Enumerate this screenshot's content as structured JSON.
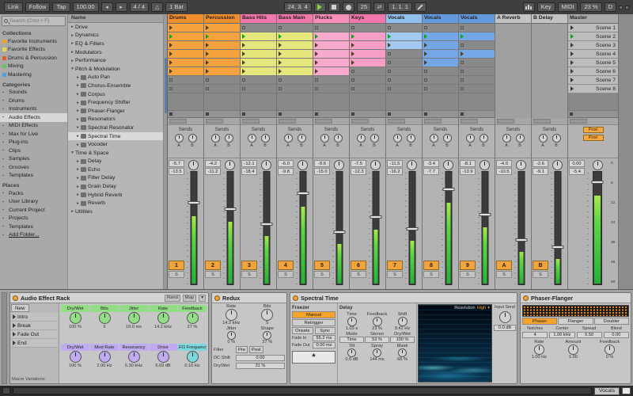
{
  "topbar": {
    "link": "Link",
    "follow": "Follow",
    "tap": "Tap",
    "tempo": "100.00",
    "timesig": "4 / 4",
    "quantize": "1 Bar",
    "position": "24. 3. 4",
    "loop_start": "25",
    "loop_length": "1. 1. 1",
    "key": "Key",
    "midi": "MIDI",
    "cpu": "23 %",
    "disk": "D"
  },
  "icons": {
    "dropdown": "▾",
    "metronome": "△",
    "nudge_left": "◂",
    "nudge_right": "▸",
    "loop": "⇄",
    "freeze": "*",
    "rack_fold": "▾"
  },
  "browser": {
    "search_placeholder": "Search (Cmd + F)",
    "name_header": "Name",
    "sections": [
      {
        "title": "Collections",
        "items": [
          {
            "label": "Favorite Instruments",
            "dot": "#f0a030"
          },
          {
            "label": "Favorite Effects",
            "dot": "#e8d84a"
          },
          {
            "label": "Drums & Percussion",
            "dot": "#e05c2c"
          },
          {
            "label": "Mixing",
            "dot": "#62c462"
          },
          {
            "label": "Mastering",
            "dot": "#50a0e0"
          }
        ]
      },
      {
        "title": "Categories",
        "items": [
          {
            "label": "Sounds"
          },
          {
            "label": "Drums"
          },
          {
            "label": "Instruments"
          },
          {
            "label": "Audio Effects",
            "selected": true
          },
          {
            "label": "MIDI Effects"
          },
          {
            "label": "Max for Live"
          },
          {
            "label": "Plug-ins"
          },
          {
            "label": "Clips"
          },
          {
            "label": "Samples"
          },
          {
            "label": "Grooves"
          },
          {
            "label": "Templates"
          }
        ]
      },
      {
        "title": "Places",
        "items": [
          {
            "label": "Packs"
          },
          {
            "label": "User Library"
          },
          {
            "label": "Current Project"
          },
          {
            "label": "Projects"
          },
          {
            "label": "Templates"
          },
          {
            "label": "Add Folder...",
            "underline": true
          }
        ]
      }
    ],
    "files": [
      {
        "label": "Drive",
        "arrow": "▸"
      },
      {
        "label": "Dynamics",
        "arrow": "▸"
      },
      {
        "label": "EQ & Filters",
        "arrow": "▸"
      },
      {
        "label": "Modulators",
        "arrow": "▸"
      },
      {
        "label": "Performance",
        "arrow": "▸"
      },
      {
        "label": "Pitch & Modulation",
        "arrow": "▾"
      },
      {
        "label": "Auto Pan",
        "arrow": "▸",
        "device": true,
        "indent": 1
      },
      {
        "label": "Chorus-Ensemble",
        "arrow": "▸",
        "device": true,
        "indent": 1
      },
      {
        "label": "Corpus",
        "arrow": "▸",
        "device": true,
        "indent": 1
      },
      {
        "label": "Frequency Shifter",
        "arrow": "▸",
        "device": true,
        "indent": 1
      },
      {
        "label": "Phaser-Flanger",
        "arrow": "▸",
        "device": true,
        "indent": 1
      },
      {
        "label": "Resonators",
        "arrow": "▸",
        "device": true,
        "indent": 1
      },
      {
        "label": "Spectral Resonator",
        "arrow": "▸",
        "device": true,
        "indent": 1
      },
      {
        "label": "Spectral Time",
        "arrow": "▸",
        "device": true,
        "indent": 1,
        "selected": true
      },
      {
        "label": "Vocoder",
        "arrow": "▸",
        "device": true,
        "indent": 1
      },
      {
        "label": "Time & Space",
        "arrow": "▾"
      },
      {
        "label": "Delay",
        "arrow": "▸",
        "device": true,
        "indent": 1
      },
      {
        "label": "Echo",
        "arrow": "▸",
        "device": true,
        "indent": 1
      },
      {
        "label": "Filter Delay",
        "arrow": "▸",
        "device": true,
        "indent": 1
      },
      {
        "label": "Grain Delay",
        "arrow": "▸",
        "device": true,
        "indent": 1
      },
      {
        "label": "Hybrid Reverb",
        "arrow": "▸",
        "device": true,
        "indent": 1
      },
      {
        "label": "Reverb",
        "arrow": "▸",
        "device": true,
        "indent": 1
      },
      {
        "label": "Utilities",
        "arrow": "▸"
      }
    ]
  },
  "session": {
    "sends_label": "Sends",
    "solo_label": "S",
    "send_letters": [
      "A",
      "B"
    ],
    "tracks": [
      {
        "name": "Drums",
        "hdr": "#ef8f2e",
        "clip": "#f5a23e",
        "num": "1",
        "slots": [
          1,
          2,
          1,
          1,
          1,
          1,
          0,
          0
        ],
        "vol": "-5.7",
        "peak": "-13.5",
        "meter": 60
      },
      {
        "name": "Percussion",
        "hdr": "#ef8f2e",
        "clip": "#f5a23e",
        "num": "2",
        "slots": [
          1,
          2,
          1,
          1,
          1,
          1,
          0,
          0
        ],
        "vol": "-4.2",
        "peak": "-11.2",
        "meter": 55
      },
      {
        "name": "Bass Hits",
        "hdr": "#f178ac",
        "clip": "#e5e77d",
        "num": "3",
        "slots": [
          0,
          2,
          1,
          1,
          1,
          1,
          0,
          0
        ],
        "vol": "-12.1",
        "peak": "-18.4",
        "meter": 42
      },
      {
        "name": "Bass Main",
        "hdr": "#f178ac",
        "clip": "#e5e77d",
        "num": "4",
        "slots": [
          0,
          2,
          1,
          1,
          1,
          1,
          0,
          0
        ],
        "vol": "-6.0",
        "peak": "-9.8",
        "meter": 68
      },
      {
        "name": "Plucks",
        "hdr": "#f78fba",
        "clip": "#f9a9cb",
        "num": "5",
        "slots": [
          0,
          2,
          1,
          1,
          1,
          1,
          0,
          0
        ],
        "vol": "-9.6",
        "peak": "-15.0",
        "meter": 35
      },
      {
        "name": "Keys",
        "hdr": "#f178ac",
        "clip": "#f79ec4",
        "num": "6",
        "slots": [
          0,
          2,
          1,
          1,
          1,
          0,
          0,
          0
        ],
        "vol": "-7.5",
        "peak": "-12.3",
        "meter": 48
      },
      {
        "name": "Vocals",
        "hdr": "#92c0ee",
        "clip": "#a3c9f1",
        "num": "7",
        "slots": [
          0,
          2,
          1,
          0,
          0,
          0,
          0,
          0
        ],
        "vol": "-11.5",
        "peak": "-16.2",
        "meter": 38
      },
      {
        "name": "Vocals",
        "hdr": "#639ade",
        "clip": "#74a7e6",
        "num": "8",
        "slots": [
          0,
          2,
          1,
          1,
          1,
          0,
          0,
          0
        ],
        "vol": "-3.4",
        "peak": "-7.7",
        "meter": 72
      },
      {
        "name": "Vocals",
        "hdr": "#639ade",
        "clip": "#74a7e6",
        "num": "9",
        "slots": [
          0,
          2,
          0,
          1,
          0,
          0,
          0,
          0
        ],
        "vol": "-8.1",
        "peak": "-13.9",
        "meter": 50
      },
      {
        "name": "A Reverb",
        "hdr": "#c3c3c3",
        "ret": true,
        "num": "A",
        "slots": [
          0,
          0,
          0,
          0,
          0,
          0,
          0,
          0
        ],
        "vol": "-4.0",
        "peak": "-10.5",
        "meter": 28
      },
      {
        "name": "B Delay",
        "hdr": "#c3c3c3",
        "ret": true,
        "num": "B",
        "slots": [
          0,
          0,
          0,
          0,
          0,
          0,
          0,
          0
        ],
        "vol": "-2.6",
        "peak": "-9.1",
        "meter": 22
      }
    ],
    "scenes": [
      {
        "label": "Scene 1"
      },
      {
        "label": "Scene 2",
        "playing": true
      },
      {
        "label": "Scene 3"
      },
      {
        "label": "Scene 4"
      },
      {
        "label": "Scene 5"
      },
      {
        "label": "Scene 6"
      },
      {
        "label": "Scene 7"
      },
      {
        "label": "Scene 8"
      }
    ],
    "master": {
      "name": "Master",
      "hdr": "#a9a9a9",
      "vol": "0.00",
      "peak": "-5.4",
      "meter": 78,
      "post_labels": [
        "Post",
        "Post"
      ],
      "scale": [
        "0",
        "6",
        "12",
        "24",
        "36",
        "48",
        "60"
      ]
    }
  },
  "devices": {
    "rack": {
      "title": "Audio Effect Rack",
      "rand_label": "Rand",
      "map_label": "Map",
      "new_label": "New",
      "variations": [
        "Intro",
        "Break",
        "Fade Out",
        "End"
      ],
      "variations_label": "Macro Variations",
      "macros": [
        {
          "label": "Dry/Wet",
          "value": "100 %",
          "color": "#93dd86"
        },
        {
          "label": "Bits",
          "value": "6",
          "color": "#93dd86"
        },
        {
          "label": "Jitter",
          "value": "10.0 ms",
          "color": "#93dd86"
        },
        {
          "label": "Rate",
          "value": "14.2 kHz",
          "color": "#93dd86"
        },
        {
          "label": "Feedback",
          "value": "27 %",
          "color": "#93dd86"
        },
        {
          "label": "Dry/Wet",
          "value": "100 %",
          "color": "#c0aaf0"
        },
        {
          "label": "Mod Rate",
          "value": "2.00 Hz",
          "color": "#c0aaf0"
        },
        {
          "label": "Resonancy",
          "value": "6.30 kHz",
          "color": "#c0aaf0"
        },
        {
          "label": "Drive",
          "value": "6.69 dB",
          "color": "#c0aaf0"
        },
        {
          "label": "LFO Frequency",
          "value": "0.10 Hz",
          "color": "#7cd8dd"
        }
      ]
    },
    "redux": {
      "title": "Redux",
      "knobs": [
        {
          "label": "Rate",
          "value": "14.2 kHz",
          "big": true
        },
        {
          "label": "Bits",
          "value": "5",
          "big": true
        },
        {
          "label": "Jitter",
          "value": "0 %"
        },
        {
          "label": "Shape",
          "value": "27 %"
        }
      ],
      "filter_label": "Filter",
      "pre": "Pre",
      "post": "Post",
      "dc_label": "DC Shift",
      "dc_value": "0.00",
      "drywet_label": "Dry/Wet",
      "drywet_value": "31 %"
    },
    "spectral": {
      "title": "Spectral Time",
      "freezer_label": "Freezer",
      "manual": "Manual",
      "retrigger": "Retrigger",
      "onsets": "Onsets",
      "sync": "Sync",
      "fade_in_label": "Fade In",
      "fade_in_value": "55.2 ms",
      "fade_out_label": "Fade Out",
      "fade_out_value": "0.00 ms",
      "delay_label": "Delay",
      "delay_knobs": [
        {
          "label": "Time",
          "value": "1.03 s"
        },
        {
          "label": "Feedback",
          "value": "23 %"
        },
        {
          "label": "Shift",
          "value": "0.42 Hz"
        }
      ],
      "delay_mid": [
        {
          "label": "Mode",
          "value": "Time"
        },
        {
          "label": "Stereo",
          "value": "53 %"
        },
        {
          "label": "Dry/Wet",
          "value": "100 %"
        }
      ],
      "delay_bottom": [
        {
          "label": "Tilt",
          "value": "0.0 dB"
        },
        {
          "label": "Spray",
          "value": "144 ms"
        },
        {
          "label": "Mask",
          "value": "66 %"
        }
      ],
      "resolution_label": "Resolution",
      "resolution_value": "High",
      "input_send_label": "Input Send",
      "input_send_value": "0.0 dB"
    },
    "phaser": {
      "title": "Phaser-Flanger",
      "modes": [
        {
          "label": "Phaser",
          "on": true
        },
        {
          "label": "Flanger"
        },
        {
          "label": "Doubler"
        }
      ],
      "params": [
        {
          "label": "Notches",
          "value": "4"
        },
        {
          "label": "Center",
          "value": "1.00 kHz"
        },
        {
          "label": "Spread",
          "value": "0.50"
        },
        {
          "label": "Blend",
          "value": "0.00"
        }
      ],
      "knobs": [
        {
          "label": "Rate",
          "value": "1.00 Hz"
        },
        {
          "label": "Amount",
          "value": "1.00"
        },
        {
          "label": "Feedback",
          "value": "0 %"
        }
      ]
    }
  },
  "status": {
    "track": "Vocals"
  }
}
